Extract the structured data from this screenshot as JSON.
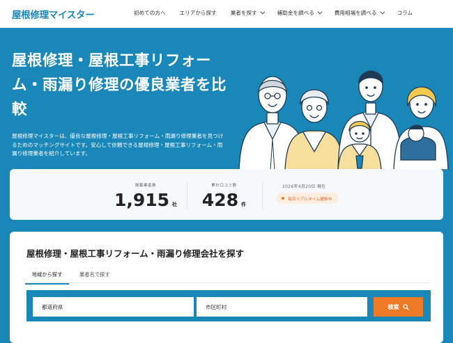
{
  "header": {
    "logo": "屋根修理マイスター",
    "nav": [
      {
        "label": "初めての方へ",
        "has_dropdown": false
      },
      {
        "label": "エリアから探す",
        "has_dropdown": false
      },
      {
        "label": "業者を探す",
        "has_dropdown": true
      },
      {
        "label": "補助金を調べる",
        "has_dropdown": true
      },
      {
        "label": "費用相場を調べる",
        "has_dropdown": true
      },
      {
        "label": "コラム",
        "has_dropdown": false
      }
    ]
  },
  "hero": {
    "title": "屋根修理・屋根工事リフォーム・雨漏り修理の優良業者を比較",
    "description": "屋根修理マイスターは、優良な屋根修理・屋根工事リフォーム・雨漏り修理業者を見つけるためのマッチングサイトです。安心して依頼できる屋根修理・屋根工事リフォーム・雨漏り修理業者を紹介しています。"
  },
  "stats": {
    "companies": {
      "label": "掲載業者数",
      "value": "1,915",
      "unit": "社"
    },
    "reviews": {
      "label": "累計口コミ数",
      "value": "428",
      "unit": "件"
    },
    "date": "2026年4月20日 現在",
    "badge": "毎日リアルタイム更新中"
  },
  "search": {
    "title": "屋根修理・屋根工事リフォーム・雨漏り修理会社を探す",
    "tabs": [
      {
        "label": "地域から探す",
        "active": true
      },
      {
        "label": "業者名で探す",
        "active": false
      }
    ],
    "prefecture_placeholder": "都道府県",
    "city_placeholder": "市区町村",
    "button": "検索"
  },
  "colors": {
    "primary": "#1a87b9",
    "accent": "#ef7a26",
    "badge_bg": "#fdeee0"
  }
}
